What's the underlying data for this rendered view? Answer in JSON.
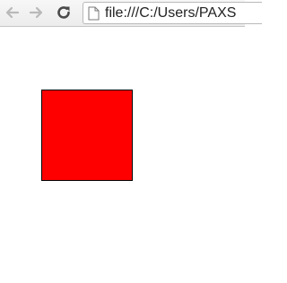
{
  "browser": {
    "address_bar": {
      "url": "file:///C:/Users/PAXS"
    },
    "icons": {
      "back": "arrow-left-icon",
      "forward": "arrow-right-icon",
      "reload": "reload-icon",
      "page": "page-icon"
    }
  },
  "page": {
    "box_color": "#ff0000",
    "box_border_color": "#000000"
  }
}
